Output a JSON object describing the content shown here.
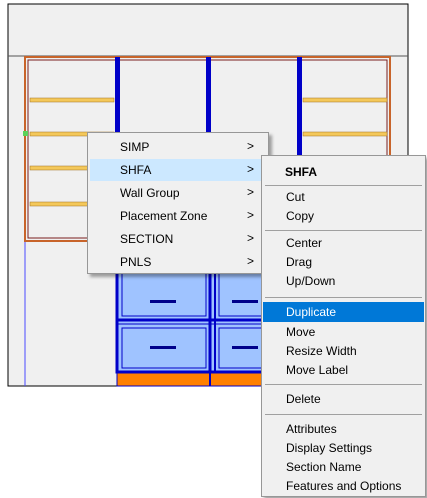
{
  "colors": {
    "accent": "#0078d7",
    "cabinet_frame": "#0000c8",
    "shelf": "#f4c85a",
    "drawer_fill": "#9fc3ff",
    "base": "#ff8000"
  },
  "context_menu": {
    "items": [
      {
        "label": "SIMP",
        "submenu": true
      },
      {
        "label": "SHFA",
        "submenu": true,
        "selected": true
      },
      {
        "label": "Wall Group",
        "submenu": true
      },
      {
        "label": "Placement Zone",
        "submenu": true
      },
      {
        "label": "SECTION",
        "submenu": true
      },
      {
        "label": "PNLS",
        "submenu": true
      }
    ],
    "arrow_glyph": ">"
  },
  "submenu": {
    "title": "SHFA",
    "groups": [
      [
        "Cut",
        "Copy"
      ],
      [
        "Center",
        "Drag",
        "Up/Down"
      ],
      [
        "Duplicate",
        "Move",
        "Resize Width",
        "Move Label"
      ],
      [
        "Delete"
      ],
      [
        "Attributes",
        "Display Settings",
        "Section Name",
        "Features and Options"
      ]
    ],
    "highlighted": "Duplicate"
  }
}
